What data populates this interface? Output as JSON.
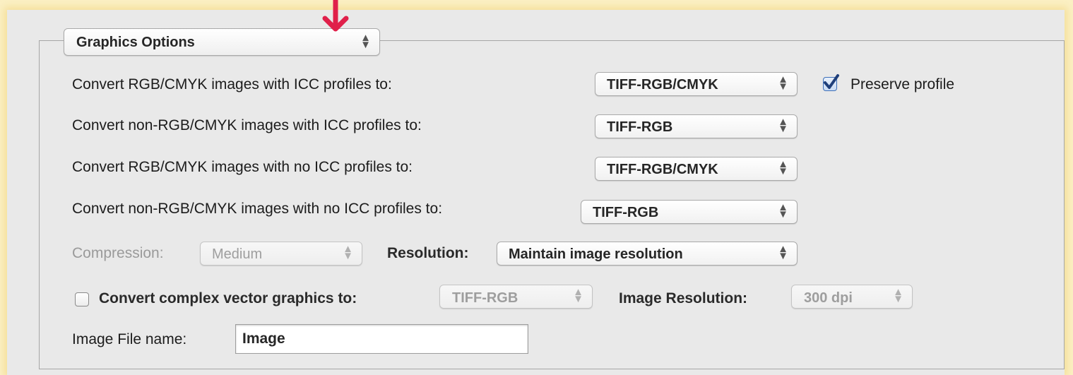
{
  "group": {
    "selector_value": "Graphics Options"
  },
  "rows": [
    {
      "label": "Convert RGB/CMYK images with ICC profiles to:",
      "value": "TIFF-RGB/CMYK"
    },
    {
      "label": "Convert non-RGB/CMYK images with ICC profiles to:",
      "value": "TIFF-RGB"
    },
    {
      "label": "Convert RGB/CMYK images with no ICC profiles to:",
      "value": "TIFF-RGB/CMYK"
    },
    {
      "label": "Convert non-RGB/CMYK images with no ICC profiles to:",
      "value": "TIFF-RGB"
    }
  ],
  "preserve_profile": {
    "label": "Preserve profile",
    "checked": true
  },
  "compression": {
    "label": "Compression:",
    "value": "Medium",
    "enabled": false
  },
  "resolution": {
    "label": "Resolution:",
    "value": "Maintain image resolution"
  },
  "complex_vector": {
    "label": "Convert complex vector graphics to:",
    "checked": false,
    "value": "TIFF-RGB",
    "image_resolution_label": "Image Resolution:",
    "image_resolution_value": "300 dpi"
  },
  "image_file_name": {
    "label": "Image File name:",
    "value": "Image"
  },
  "icons": {
    "popup_arrows": "up-down-chevrons-icon",
    "annotation": "red-down-arrow-icon",
    "checkmark": "checkmark-icon"
  },
  "colors": {
    "page_glow": "#fbf0c4",
    "panel_background": "#e9e9e9",
    "annotation_arrow": "#e0204a",
    "checkbox_accent": "#3d6fb8"
  }
}
